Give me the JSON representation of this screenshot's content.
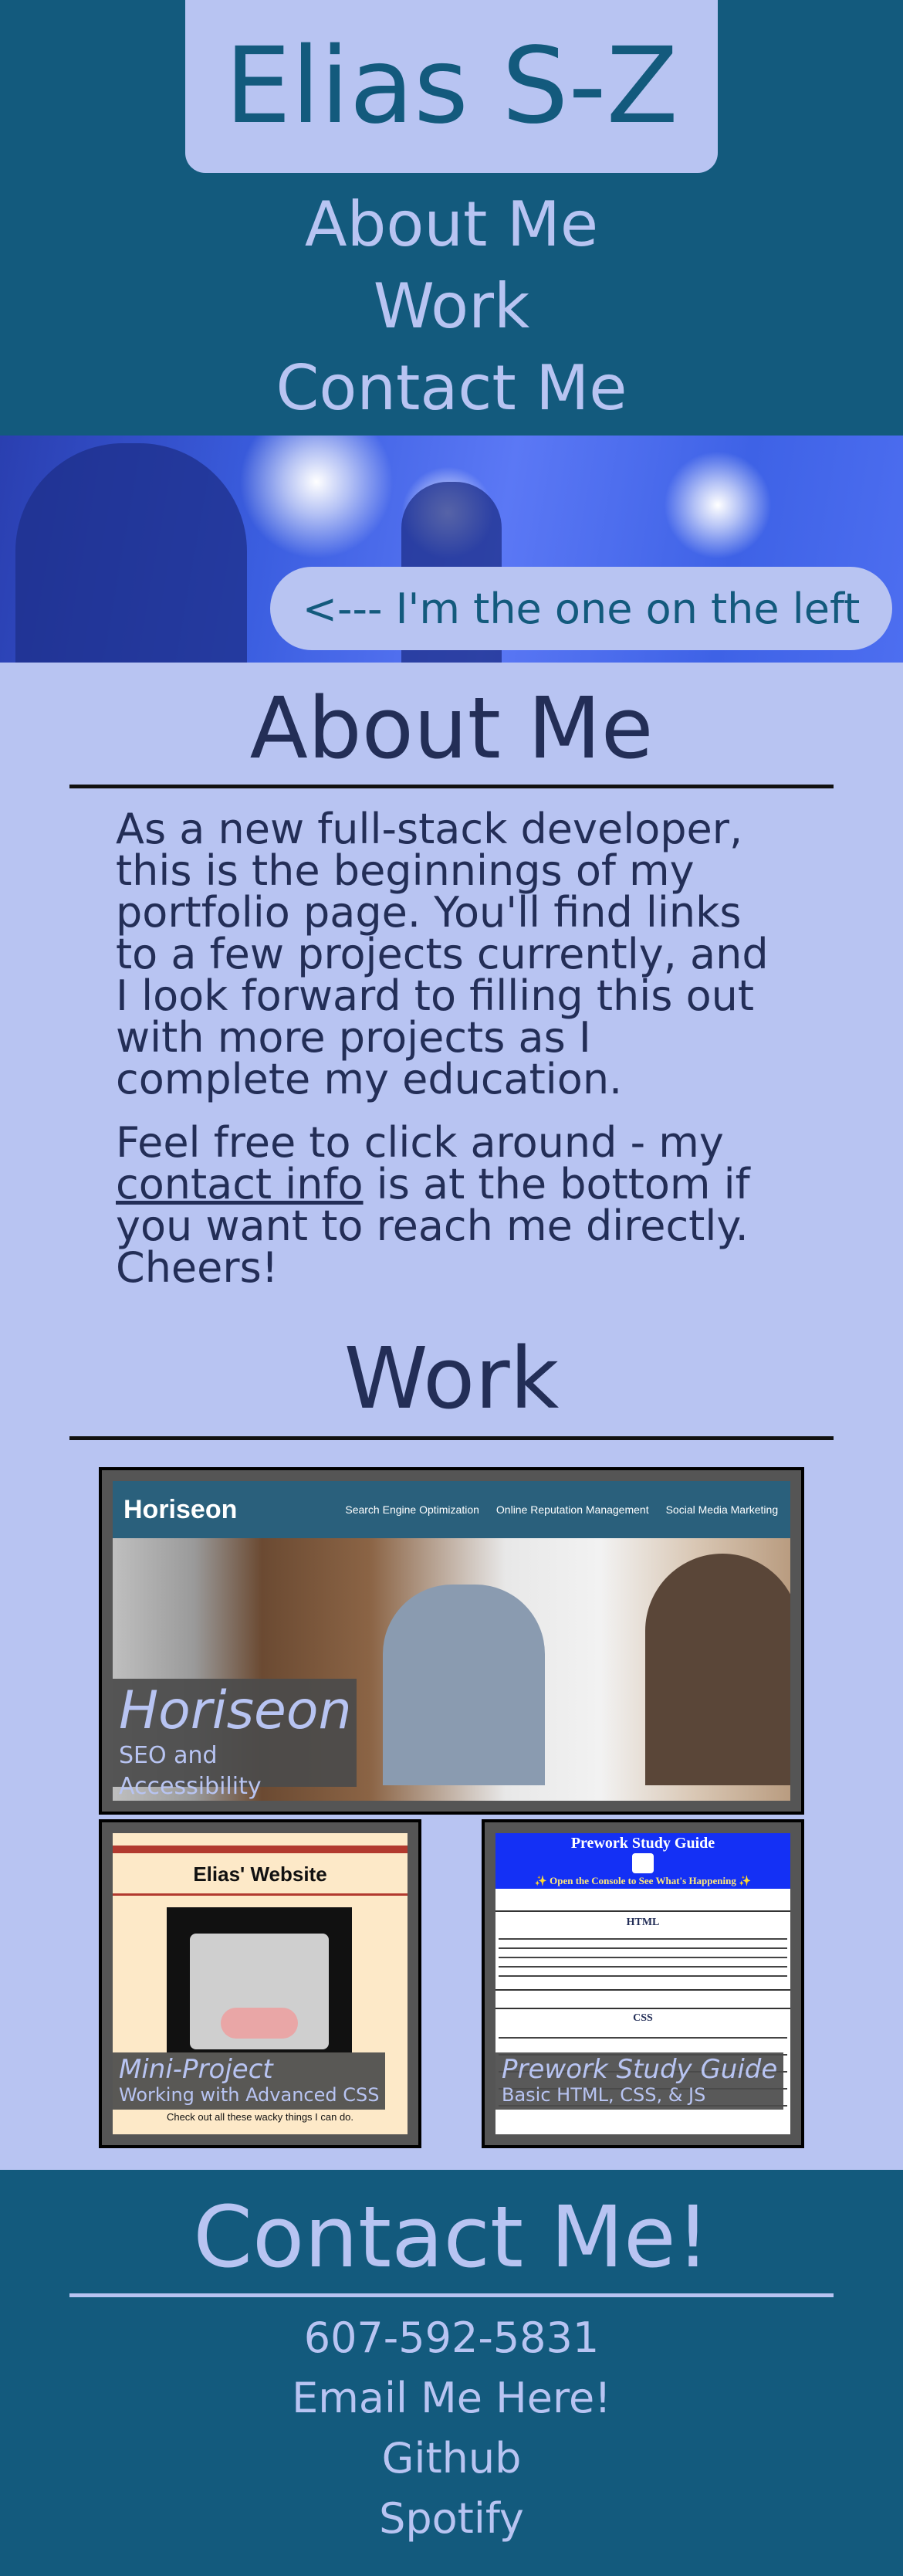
{
  "header": {
    "name": "Elias S-Z",
    "nav": [
      "About Me",
      "Work",
      "Contact Me"
    ]
  },
  "hero": {
    "caption": "<--- I'm the one on the left"
  },
  "about": {
    "title": "About Me",
    "p1": "As a new full-stack developer, this is the beginnings of my portfolio page. You'll find links to a few projects currently, and I look forward to filling this out with more projects as I complete my education.",
    "p2_before": "Feel free to click around - my ",
    "p2_link": "contact info",
    "p2_after": " is at the bottom if you want to reach me directly. Cheers!"
  },
  "work": {
    "title": "Work",
    "projects": [
      {
        "title": "Horiseon",
        "subtitle": "SEO and Accessibility",
        "screenshot": {
          "logo": "Horiseon",
          "nav": [
            "Search Engine Optimization",
            "Online Reputation Management",
            "Social Media Marketing"
          ]
        }
      },
      {
        "title": "Mini-Project",
        "subtitle": "Working with Advanced CSS",
        "screenshot": {
          "heading": "Elias' Website",
          "footer_text": "Check out all these wacky things I can do."
        }
      },
      {
        "title": "Prework Study Guide",
        "subtitle": "Basic HTML, CSS, & JS",
        "screenshot": {
          "heading": "Prework Study Guide",
          "banner": "✨ Open the Console to See What's Happening ✨",
          "section1": "HTML",
          "section2": "CSS"
        }
      }
    ]
  },
  "contact": {
    "title": "Contact Me!",
    "links": [
      "607-592-5831",
      "Email Me Here!",
      "Github",
      "Spotify"
    ]
  },
  "colors": {
    "dark_teal": "#135a7d",
    "lavender": "#b8c4f2",
    "navy_text": "#232e57"
  }
}
